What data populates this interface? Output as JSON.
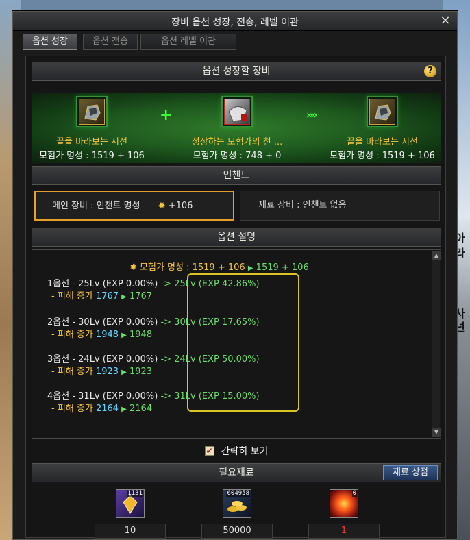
{
  "window": {
    "title": "장비 옵션 성장, 전송, 레벨 이관",
    "close_label": "×"
  },
  "tabs": [
    {
      "label": "옵션 성장",
      "active": true
    },
    {
      "label": "옵션 전송",
      "active": false
    },
    {
      "label": "옵션 레벨 이관",
      "active": false
    }
  ],
  "growth": {
    "header": "옵션 성장할 장비",
    "help_label": "?",
    "plus_symbol": "+",
    "arrows_symbol": "»»",
    "left_item": {
      "name": "끝을 바라보는 시선",
      "stat": "모험가 명성 : 1519 + 106"
    },
    "mid_item": {
      "name": "성장하는 모험가의 천 ...",
      "stat": "모험가 명성 : 748 + 0"
    },
    "right_item": {
      "name": "끝을 바라보는 시선",
      "stat": "모험가 명성 : 1519 + 106"
    }
  },
  "enchant": {
    "header": "인챈트",
    "main_label": "메인 장비 : 인챈트 명성",
    "main_value": "+106",
    "material_label": "재료 장비 : 인챈트 없음"
  },
  "options": {
    "header": "옵션 설명",
    "fame_label": "모험가 명성 : 1519 + 106",
    "fame_result": "1519 + 106",
    "rows": [
      {
        "line": "1옵션 - 25Lv (EXP 0.00%)",
        "arrow": "->",
        "result": "25Lv (EXP 42.86%)",
        "sub_label": "- 피해 증가",
        "sub_from": "1767",
        "sub_to": "1767"
      },
      {
        "line": "2옵션 - 30Lv (EXP 0.00%)",
        "arrow": "->",
        "result": "30Lv (EXP 17.65%)",
        "sub_label": "- 피해 증가",
        "sub_from": "1948",
        "sub_to": "1948"
      },
      {
        "line": "3옵션 - 24Lv (EXP 0.00%)",
        "arrow": "->",
        "result": "24Lv (EXP 50.00%)",
        "sub_label": "- 피해 증가",
        "sub_from": "1923",
        "sub_to": "1923"
      },
      {
        "line": "4옵션 - 31Lv (EXP 0.00%)",
        "arrow": "->",
        "result": "31Lv (EXP 15.00%)",
        "sub_label": "- 피해 증가",
        "sub_from": "2164",
        "sub_to": "2164"
      }
    ],
    "simple_view_label": "간략히 보기",
    "simple_view_checked": true
  },
  "materials": {
    "header": "필요재료",
    "store_button": "재료 상점",
    "items": [
      {
        "icon": "gold-crystal-icon",
        "count": "1131",
        "value": "10"
      },
      {
        "icon": "gold-coins-icon",
        "count": "604958",
        "value": "50000"
      },
      {
        "icon": "red-orb-icon",
        "count": "0",
        "value": "1"
      }
    ]
  },
  "background": {
    "right_chars": [
      "아",
      "라",
      "",
      "사",
      "넌"
    ]
  }
}
